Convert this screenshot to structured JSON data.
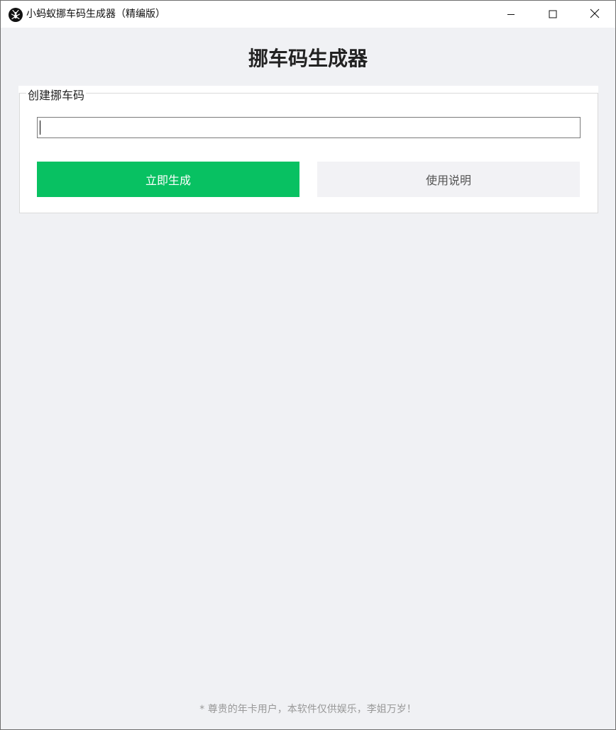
{
  "window": {
    "title": "小蚂蚁挪车码生成器（精编版）"
  },
  "header": {
    "title": "挪车码生成器"
  },
  "panel": {
    "legend": "创建挪车码",
    "input_value": "",
    "generate_label": "立即生成",
    "help_label": "使用说明"
  },
  "footer": {
    "text": "* 尊贵的年卡用户，本软件仅供娱乐，李姐万岁！"
  },
  "colors": {
    "primary_green": "#08c162",
    "background": "#f0f1f4"
  },
  "icons": {
    "app": "ant-logo-icon",
    "minimize": "minimize-icon",
    "maximize": "maximize-icon",
    "close": "close-icon"
  }
}
